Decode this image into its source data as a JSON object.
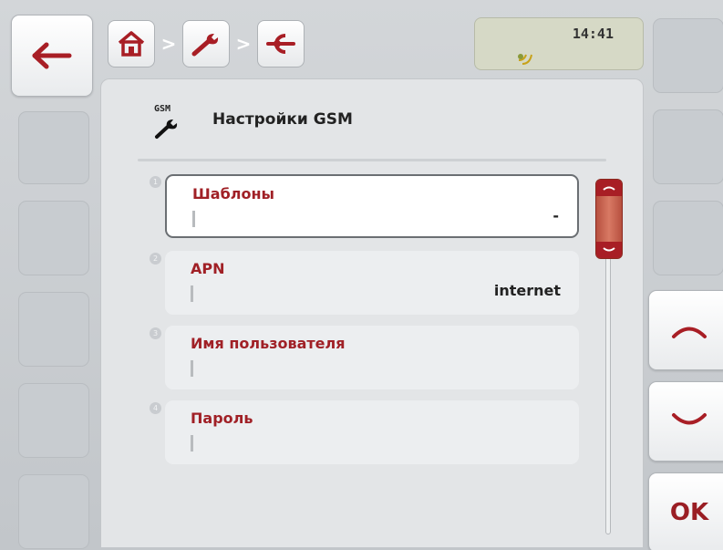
{
  "status": {
    "time": "14:41",
    "signal_icon": "gps-signal-icon"
  },
  "breadcrumb": [
    {
      "name": "home",
      "icon": "home-icon"
    },
    {
      "name": "settings",
      "icon": "wrench-icon"
    },
    {
      "name": "connection",
      "icon": "plug-icon"
    }
  ],
  "breadcrumb_separator": ">",
  "header": {
    "icon_caption": "GSM",
    "title": "Настройки GSM"
  },
  "rows": [
    {
      "index": "1",
      "label": "Шаблоны",
      "value": "-",
      "selected": true
    },
    {
      "index": "2",
      "label": "APN",
      "value": "internet",
      "selected": false
    },
    {
      "index": "3",
      "label": "Имя пользователя",
      "value": "",
      "selected": false
    },
    {
      "index": "4",
      "label": "Пароль",
      "value": "",
      "selected": false
    }
  ],
  "right_buttons": {
    "ok_label": "OK",
    "up_icon": "chevron-up-icon",
    "down_icon": "chevron-down-icon"
  },
  "left_buttons": {
    "back_icon": "back-arrow-icon"
  },
  "colors": {
    "accent": "#a02026",
    "scroll_thumb": "#c96652"
  },
  "scroll": {
    "position_fraction": 0.0
  }
}
